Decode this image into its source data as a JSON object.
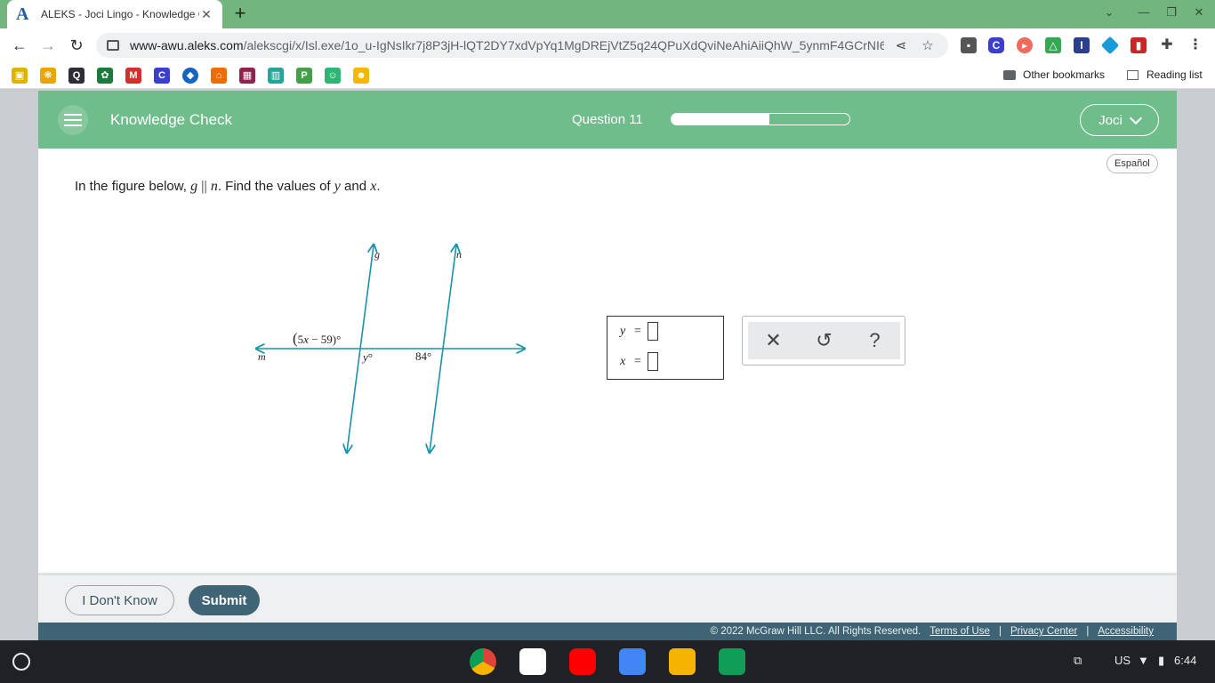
{
  "browser": {
    "tab_favicon": "A",
    "tab_title": "ALEKS - Joci Lingo - Knowledge Check",
    "tab_close": "✕",
    "new_tab": "+",
    "url_host": "www-awu.aleks.com",
    "url_path": "/alekscgi/x/Isl.exe/1o_u-IgNsIkr7j8P3jH-lQT2DY7xdVpYq1MgDREjVtZ5q24QPuXdQviNeAhiAiiQhW_5ynmF4GCrNI6...",
    "bookmarks_right": {
      "other": "Other bookmarks",
      "reading": "Reading list"
    }
  },
  "header": {
    "title": "Knowledge Check",
    "question_label": "Question 11",
    "progress": 0.55,
    "user": "Joci"
  },
  "language_link": "Español",
  "question": {
    "prefix": "In the figure below, ",
    "line1": "g",
    "parallel": "||",
    "line2": "n",
    "middle": ". Find the values of ",
    "var_y": "y",
    "and": " and ",
    "var_x": "x",
    "end": "."
  },
  "figure": {
    "label_g": "g",
    "label_n": "n",
    "label_m": "m",
    "angle_expr_open": "(",
    "angle_expr_5": "5",
    "angle_expr_x": "x",
    "angle_expr_rest": " − 59",
    "angle_expr_close": ")°",
    "angle_y_var": "y",
    "angle_y_deg": "°",
    "angle_84": "84°",
    "line_color": "#1a93a8"
  },
  "answers": {
    "y_label": "y",
    "x_label": "x",
    "equals": "="
  },
  "tools": {
    "clear": "✕",
    "undo": "↺",
    "help": "?"
  },
  "footer": {
    "dont_know": "I Don't Know",
    "submit": "Submit",
    "copyright": "© 2022 McGraw Hill LLC. All Rights Reserved.",
    "terms": "Terms of Use",
    "privacy": "Privacy Center",
    "accessibility": "Accessibility",
    "sep": "|"
  },
  "os": {
    "locale": "US",
    "time": "6:44"
  }
}
